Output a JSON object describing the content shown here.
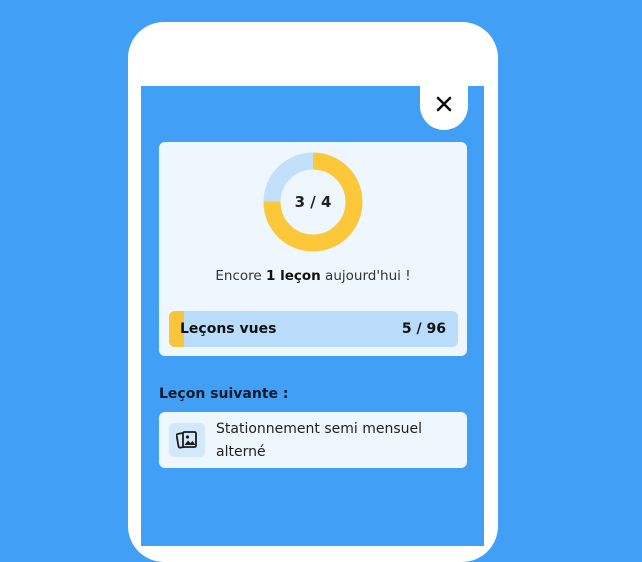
{
  "close": {
    "icon": "close-icon"
  },
  "progress_ring": {
    "label": "3 / 4",
    "completed": 3,
    "total": 4,
    "color_done": "#fcc83a",
    "color_remaining": "#c2e0fb"
  },
  "message": {
    "prefix": "Encore ",
    "count": "1 leçon",
    "suffix": " aujourd'hui !"
  },
  "lessons_seen": {
    "label": "Leçons vues",
    "count": "5 / 96",
    "seen": 5,
    "total": 96,
    "color": "#f7c43a"
  },
  "next": {
    "title": "Leçon suivante :",
    "lesson_title": "Stationnement semi mensuel alterné",
    "icon": "photo-cards-icon"
  }
}
